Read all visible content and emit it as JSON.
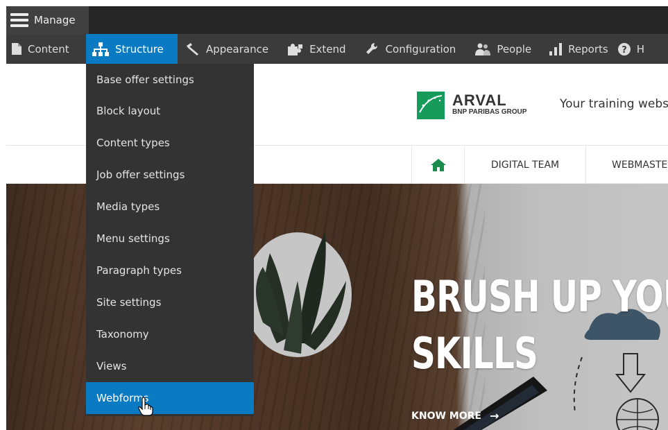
{
  "toolbar": {
    "manage_label": "Manage",
    "tray": [
      {
        "label": "Content",
        "icon": "file-icon"
      },
      {
        "label": "Structure",
        "icon": "sitemap-icon"
      },
      {
        "label": "Appearance",
        "icon": "paintbrush-icon"
      },
      {
        "label": "Extend",
        "icon": "puzzle-icon"
      },
      {
        "label": "Configuration",
        "icon": "wrench-icon"
      },
      {
        "label": "People",
        "icon": "people-icon"
      },
      {
        "label": "Reports",
        "icon": "bar-chart-icon"
      },
      {
        "label": "H",
        "icon": "help-icon"
      }
    ],
    "active_tray": "Structure",
    "accent_color": "#0a7bc2"
  },
  "structure_menu": {
    "items": [
      "Base offer settings",
      "Block layout",
      "Content types",
      "Job offer settings",
      "Media types",
      "Menu settings",
      "Paragraph types",
      "Site settings",
      "Taxonomy",
      "Views",
      "Webforms"
    ],
    "highlighted": "Webforms"
  },
  "site": {
    "logo_name": "ARVAL",
    "logo_group": "BNP PARIBAS GROUP",
    "tagline": "Your training webs",
    "nav": {
      "home_icon": "home-icon",
      "digital_team": "DIGITAL TEAM",
      "webmaster": "WEBMASTEI"
    },
    "hero": {
      "title_line1": "BRUSH UP YOUR",
      "title_line2": "SKILLS",
      "cta": "KNOW MORE",
      "cta_arrow": "→"
    }
  }
}
